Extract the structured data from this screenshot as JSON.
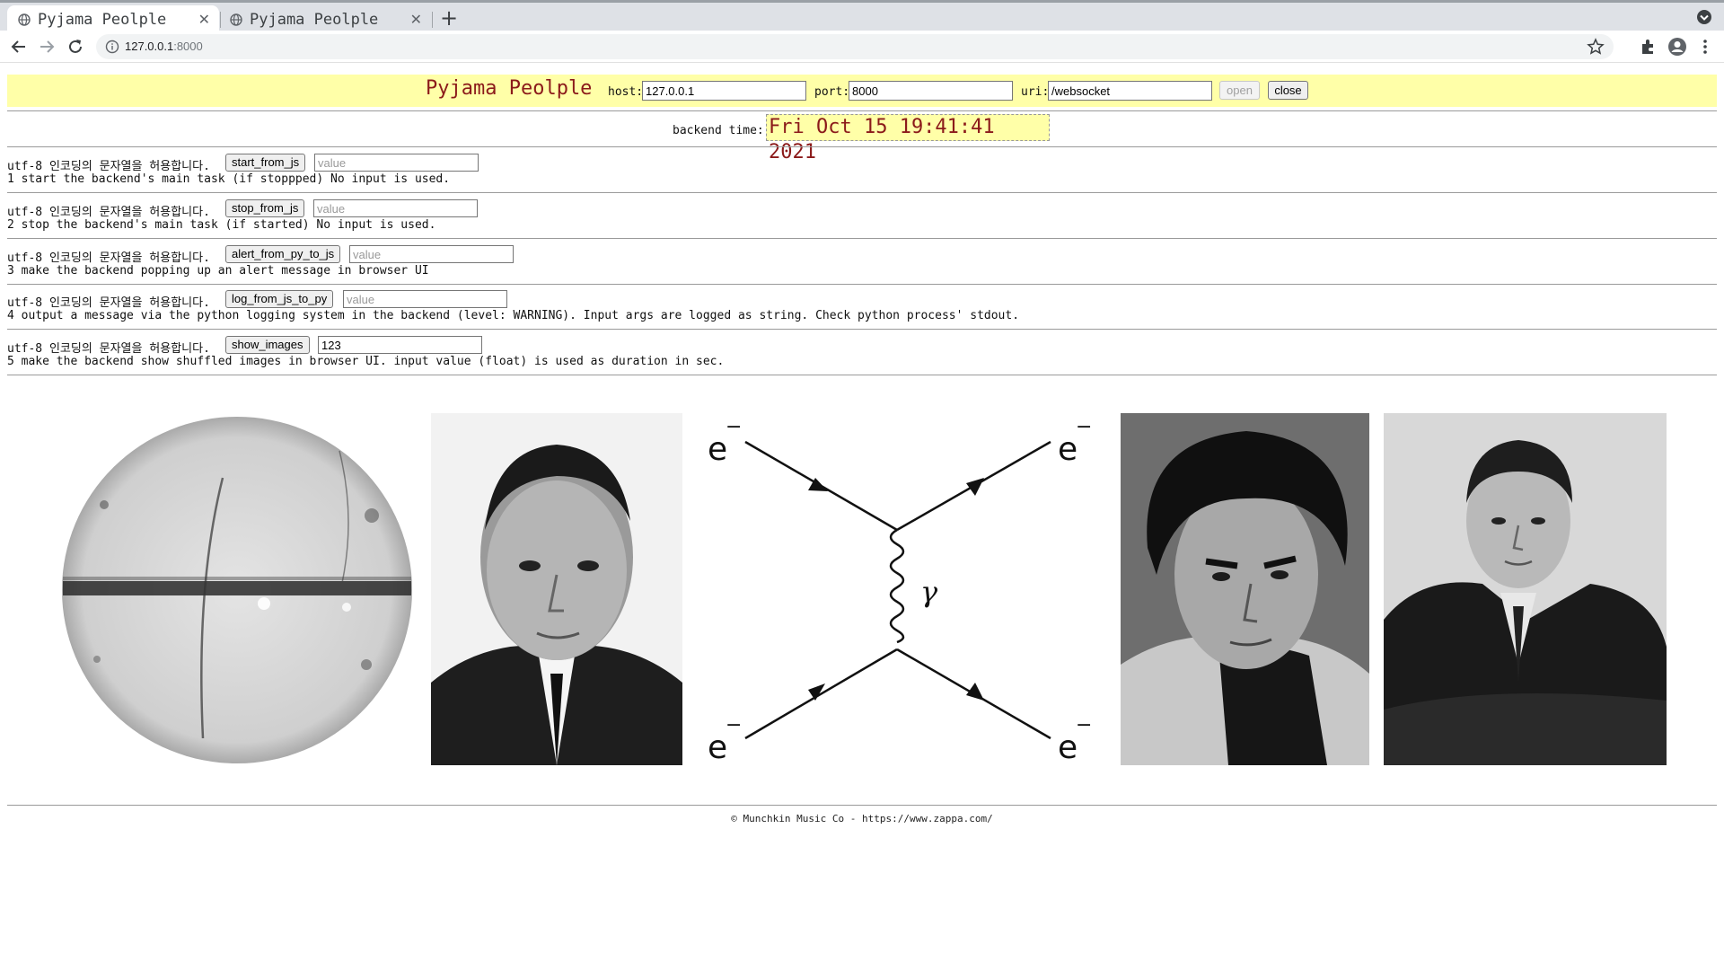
{
  "browser": {
    "tabs": [
      {
        "title": "Pyjama Peolple",
        "active": true
      },
      {
        "title": "Pyjama Peolple",
        "active": false
      }
    ],
    "url_host": "127.0.0.1",
    "url_port": ":8000"
  },
  "header": {
    "title": "Pyjama Peolple",
    "host_label": "host:",
    "host_value": "127.0.0.1",
    "port_label": "port:",
    "port_value": "8000",
    "uri_label": "uri:",
    "uri_value": "/websocket",
    "open_label": "open",
    "close_label": "close"
  },
  "backend": {
    "label": "backend time:",
    "time": "Fri Oct 15 19:41:41 2021"
  },
  "rows": [
    {
      "prefix": "utf-8 인코딩의 문자열을 허용합니다.",
      "button": "start_from_js",
      "placeholder": "value",
      "value": "",
      "desc": "1 start the backend's main task (if stoppped) No input is used."
    },
    {
      "prefix": "utf-8 인코딩의 문자열을 허용합니다.",
      "button": "stop_from_js",
      "placeholder": "value",
      "value": "",
      "desc": "2 stop the backend's main task (if started) No input is used."
    },
    {
      "prefix": "utf-8 인코딩의 문자열을 허용합니다.",
      "button": "alert_from_py_to_js",
      "placeholder": "value",
      "value": "",
      "desc": "3 make the backend popping up an alert message in browser UI"
    },
    {
      "prefix": "utf-8 인코딩의 문자열을 허용합니다.",
      "button": "log_from_js_to_py",
      "placeholder": "value",
      "value": "",
      "desc": "4 output a message via the python logging system in the backend (level: WARNING). Input args are logged as string. Check python process' stdout."
    },
    {
      "prefix": "utf-8 인코딩의 문자열을 허용합니다.",
      "button": "show_images",
      "placeholder": "",
      "value": "123",
      "desc": "5 make the backend show shuffled images in browser UI. input value (float) is used as duration in sec."
    }
  ],
  "images": {
    "feynman": {
      "e": "e",
      "minus": "−",
      "gamma": "γ"
    }
  },
  "footer": "© Munchkin Music Co - https://www.zappa.com/"
}
